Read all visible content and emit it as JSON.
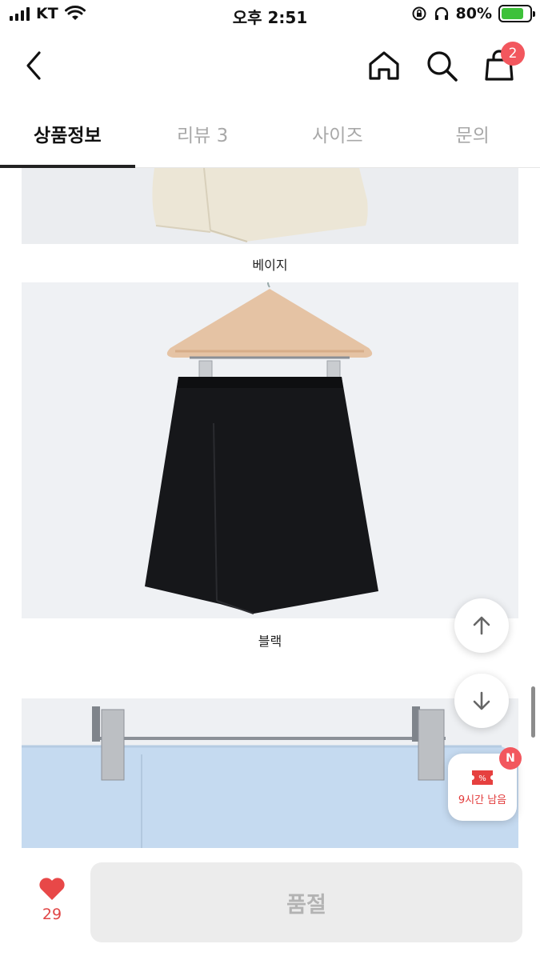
{
  "status_bar": {
    "carrier": "KT",
    "time": "오후 2:51",
    "battery": "80%",
    "battery_level": 0.8
  },
  "nav": {
    "cart_count": "2"
  },
  "tabs": [
    {
      "label": "상품정보",
      "active": true
    },
    {
      "label": "리뷰 3",
      "active": false
    },
    {
      "label": "사이즈",
      "active": false
    },
    {
      "label": "문의",
      "active": false
    }
  ],
  "products": {
    "captions": [
      "베이지",
      "블랙"
    ]
  },
  "coupon": {
    "badge": "N",
    "text": "9시간 남음"
  },
  "bottom_bar": {
    "like_count": "29",
    "soldout_label": "품절"
  },
  "colors": {
    "accent_red": "#f2575e",
    "like_red": "#e04646",
    "tab_active": "#222222",
    "tab_inactive": "#a8a8a8"
  }
}
